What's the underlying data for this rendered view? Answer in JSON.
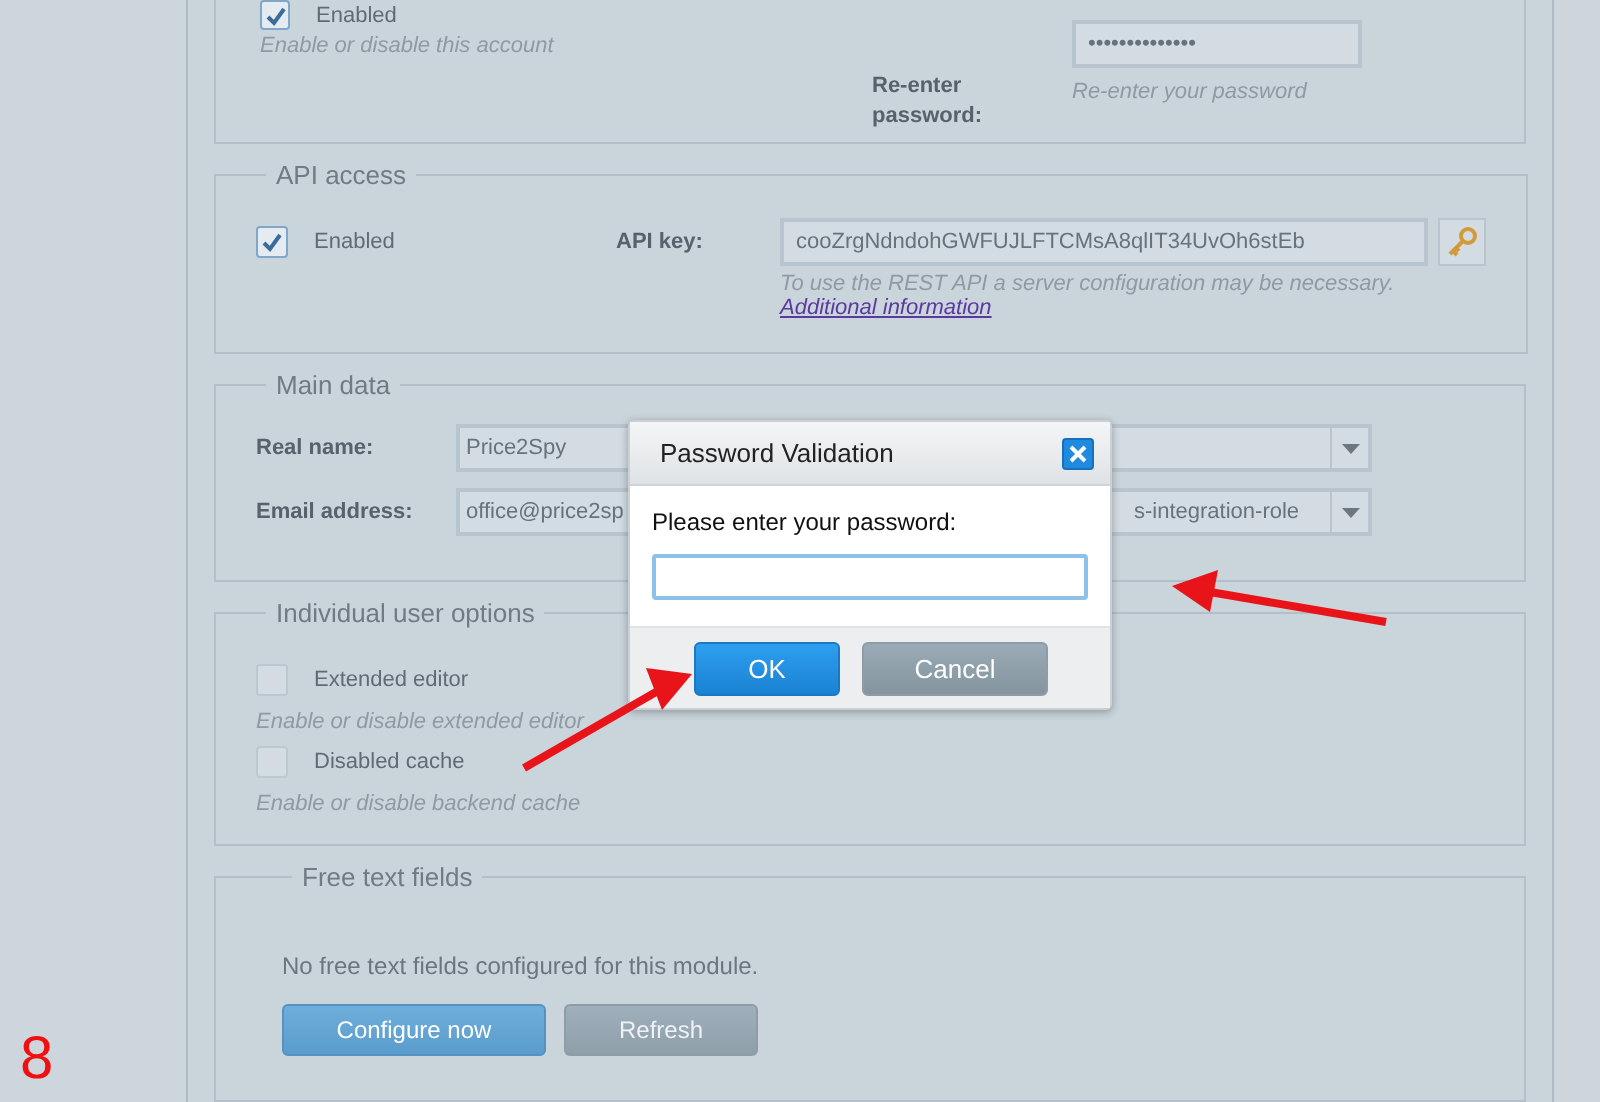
{
  "account": {
    "checkbox_label": "Enabled",
    "checked": true,
    "hint": "Enable or disable this account",
    "reenter_label": "Re-enter password:",
    "reenter_value": "••••••••••••••",
    "reenter_hint": "Re-enter your password"
  },
  "api_access": {
    "legend": "API access",
    "checkbox_label": "Enabled",
    "checked": true,
    "key_label": "API key:",
    "key_value": "cooZrgNdndohGWFUJLFTCMsA8qlIT34UvOh6stEb",
    "hint": "To use the REST API a server configuration may be necessary.",
    "link": "Additional information"
  },
  "main_data": {
    "legend": "Main data",
    "rows": [
      {
        "label": "Real name:",
        "value": "Price2Spy"
      },
      {
        "label": "Email address:",
        "value": "office@price2sp",
        "select_value": "s-integration-role"
      }
    ]
  },
  "user_options": {
    "legend": "Individual user options",
    "options": [
      {
        "label": "Extended editor",
        "checked": false,
        "hint": "Enable or disable extended editor"
      },
      {
        "label": "Disabled cache",
        "checked": false,
        "hint": "Enable or disable backend cache"
      }
    ]
  },
  "free_text": {
    "legend": "Free text fields",
    "message": "No free text fields configured for this module.",
    "buttons": [
      {
        "label": "Configure now",
        "kind": "primary"
      },
      {
        "label": "Refresh",
        "kind": "secondary"
      }
    ]
  },
  "dialog": {
    "title": "Password Validation",
    "prompt": "Please enter your password:",
    "buttons": [
      {
        "label": "OK",
        "kind": "primary"
      },
      {
        "label": "Cancel",
        "kind": "secondary"
      }
    ]
  },
  "page_number": "8"
}
